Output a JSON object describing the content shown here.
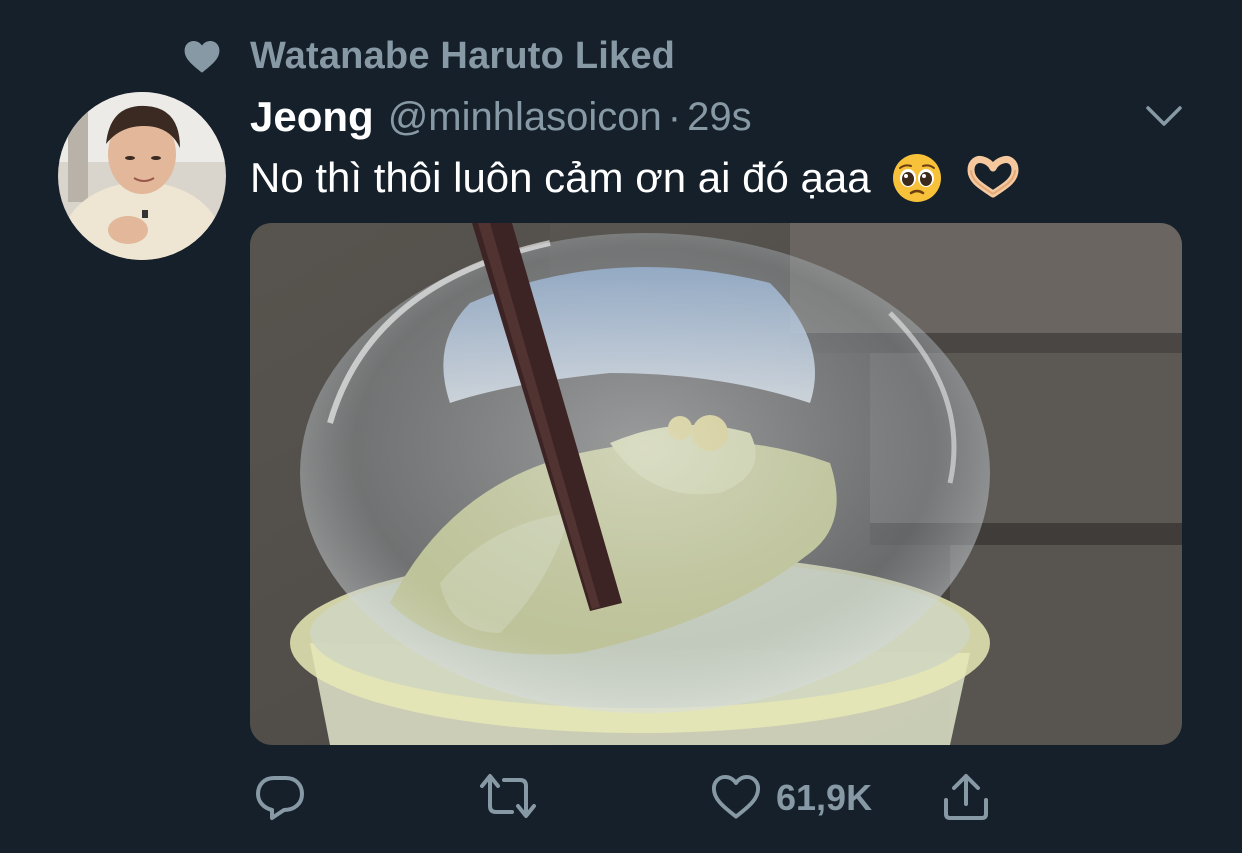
{
  "context": {
    "icon": "heart-filled-icon",
    "text": "Watanabe Haruto Liked"
  },
  "tweet": {
    "display_name": "Jeong",
    "handle": "@minhlasoicon",
    "separator": "·",
    "time": "29s",
    "text": "No thì thôi luôn cảm ơn ai đó ạaa",
    "emojis": [
      "pleading-face-emoji",
      "heart-hands-emoji"
    ],
    "media_description_icon": "photo-of-iced-drink-cup"
  },
  "actions": {
    "reply": {
      "icon": "reply-icon"
    },
    "retweet": {
      "icon": "retweet-icon"
    },
    "like": {
      "icon": "heart-outline-icon",
      "count": "61,9K"
    },
    "share": {
      "icon": "share-icon"
    }
  },
  "colors": {
    "background": "#15202b",
    "secondary_text": "#8899a6",
    "primary_text": "#ffffff"
  }
}
